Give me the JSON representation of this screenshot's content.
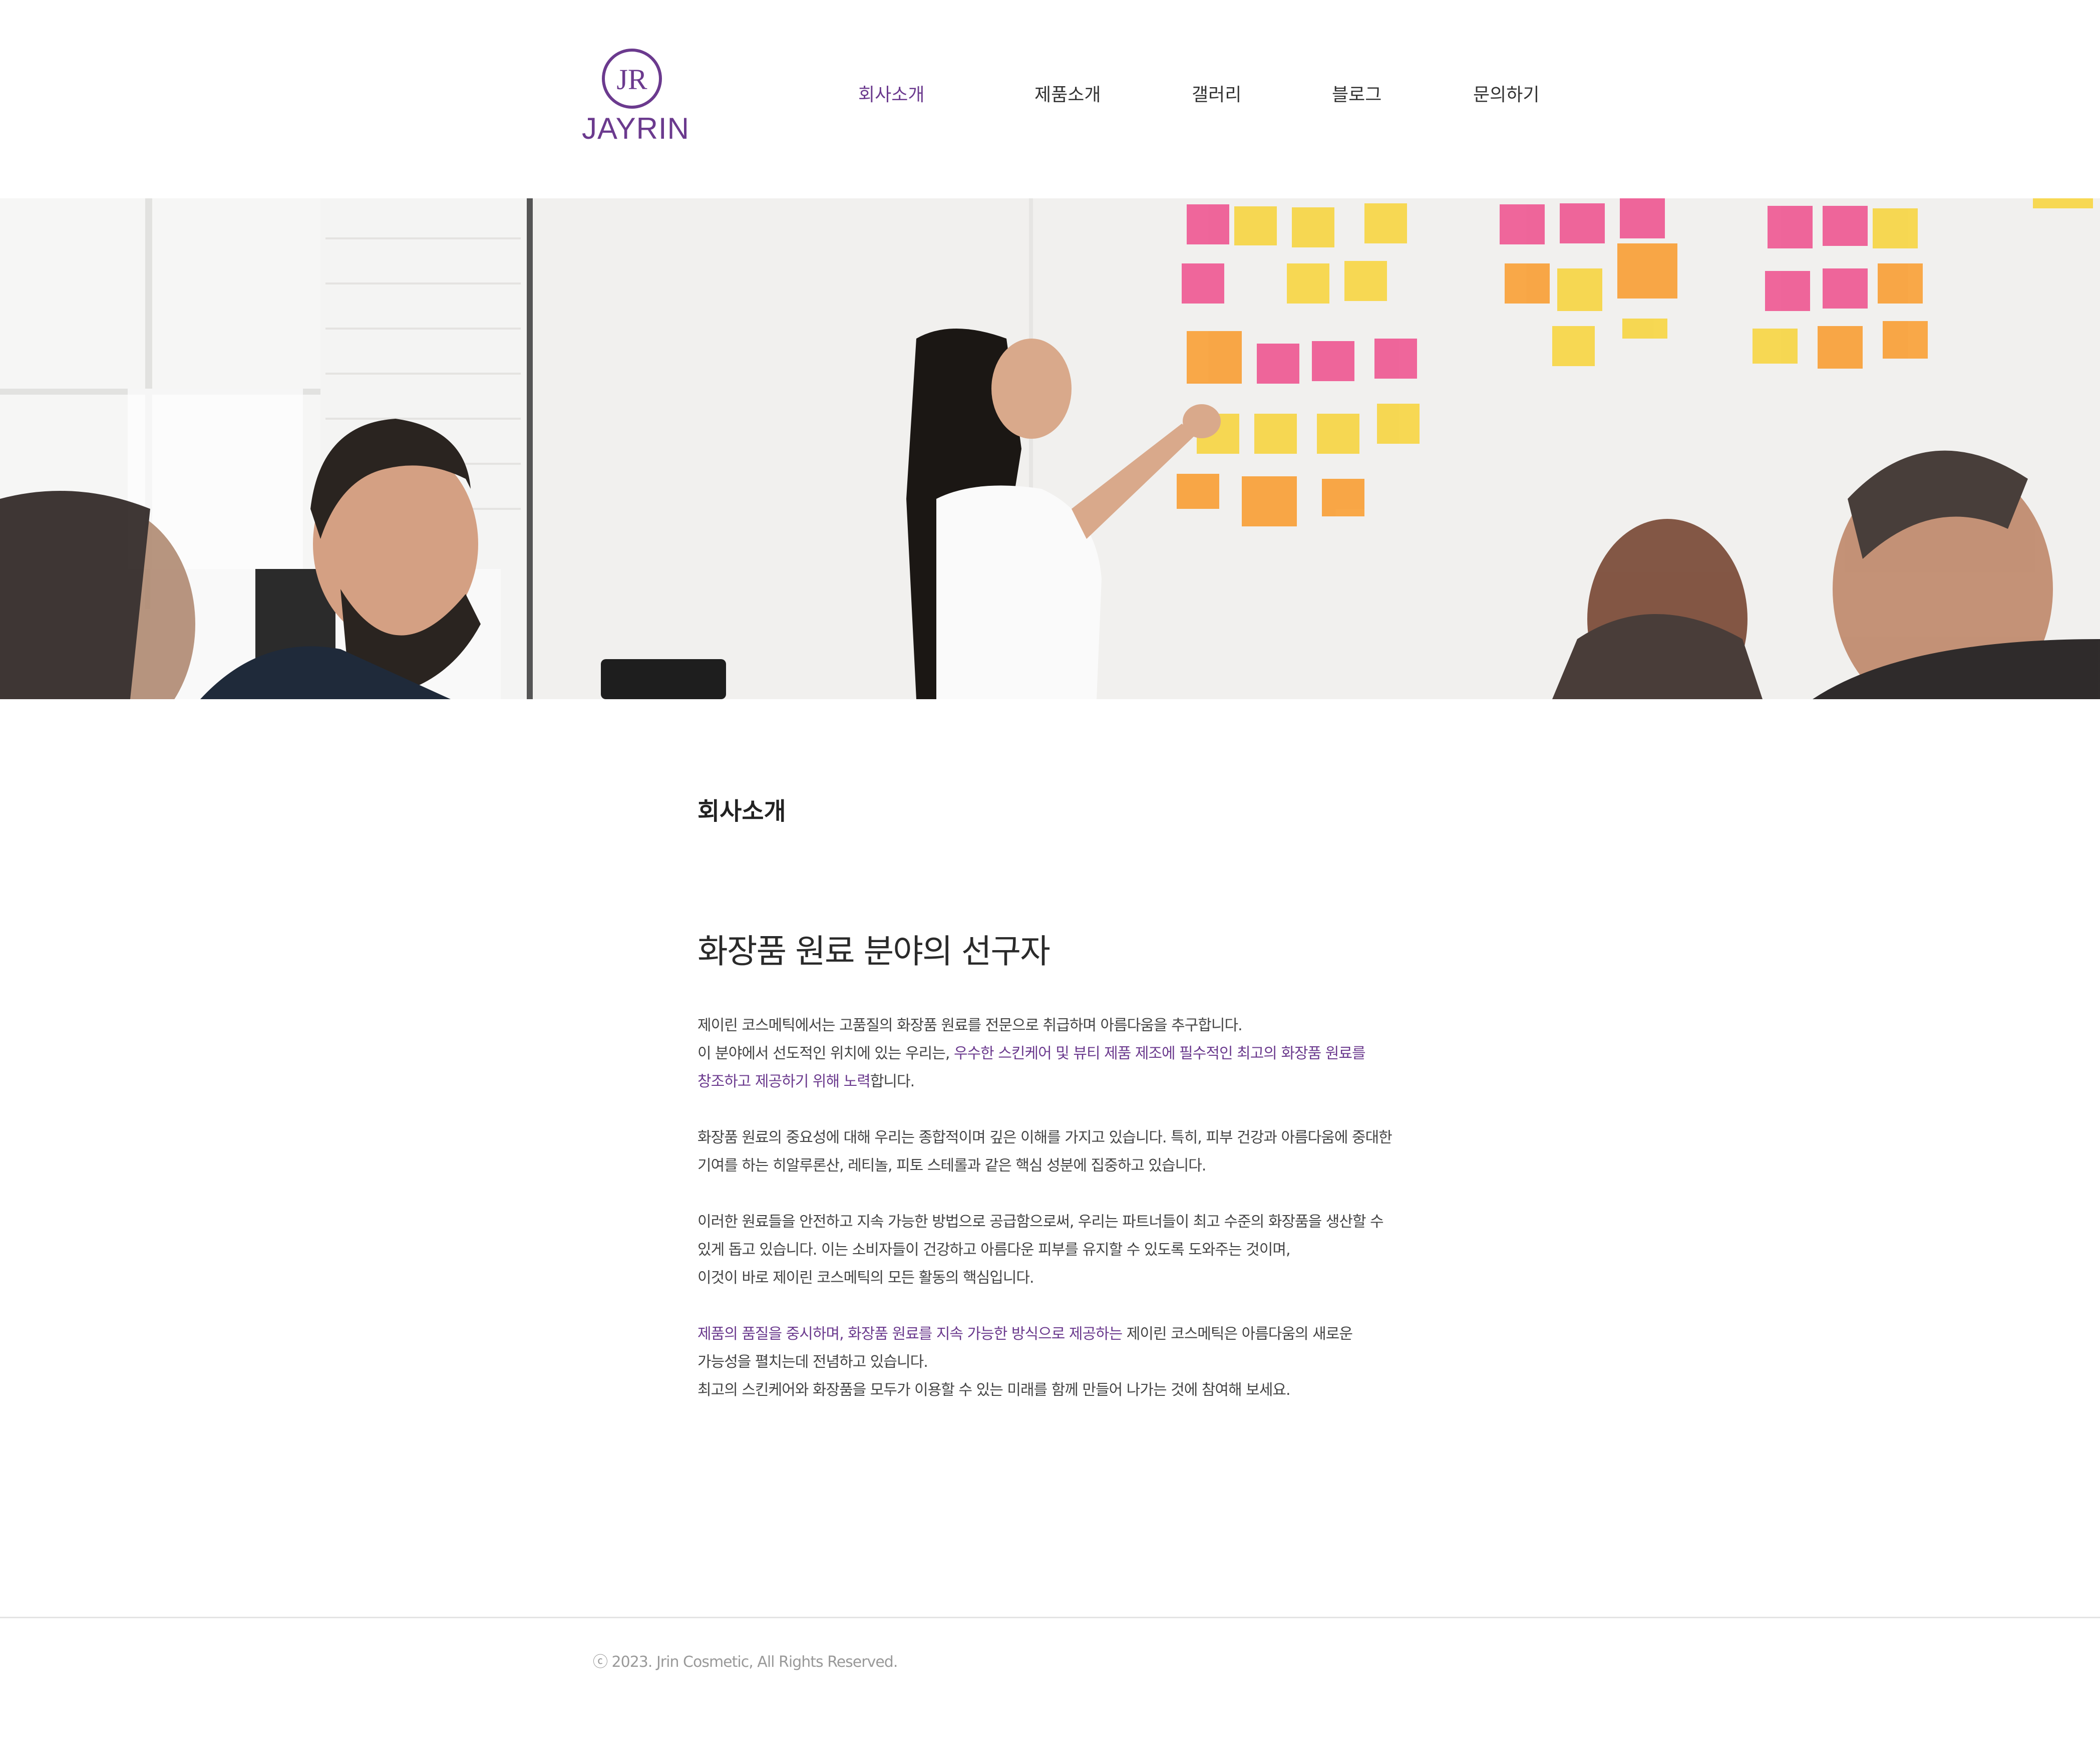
{
  "header": {
    "logo_text": "JAYRIN",
    "logo_mark": "JR",
    "nav": [
      {
        "label": "회사소개",
        "active": true
      },
      {
        "label": "제품소개",
        "active": false
      },
      {
        "label": "갤러리",
        "active": false
      },
      {
        "label": "블로그",
        "active": false
      },
      {
        "label": "문의하기",
        "active": false
      }
    ]
  },
  "hero": {
    "description_icon": "meeting-photo"
  },
  "content": {
    "section_label": "회사소개",
    "headline": "화장품 원료 분야의 선구자",
    "paragraphs": [
      {
        "lines": [
          {
            "plain_before": "제이린 코스메틱에서는 고품질의 화장품 원료를 전문으로 취급하며 아름다움을 추구합니다."
          },
          {
            "plain_before": "이 분야에서 선도적인 위치에 있는 우리는, ",
            "highlight": "우수한 스킨케어 및 뷰티 제품 제조에 필수적인 최고의 화장품 원료를"
          },
          {
            "highlight": "창조하고 제공하기 위해 노력",
            "plain_after": "합니다."
          }
        ]
      },
      {
        "lines": [
          {
            "plain_before": "화장품 원료의 중요성에 대해 우리는 종합적이며 깊은 이해를 가지고 있습니다. 특히, 피부 건강과 아름다움에 중대한"
          },
          {
            "plain_before": "기여를 하는 히알루론산, 레티놀, 피토 스테롤과 같은 핵심 성분에 집중하고 있습니다."
          }
        ]
      },
      {
        "lines": [
          {
            "plain_before": "이러한 원료들을 안전하고 지속 가능한 방법으로 공급함으로써, 우리는 파트너들이 최고 수준의 화장품을 생산할 수"
          },
          {
            "plain_before": "있게 돕고 있습니다. 이는 소비자들이 건강하고 아름다운 피부를 유지할 수 있도록 도와주는 것이며,"
          },
          {
            "plain_before": "이것이 바로 제이린 코스메틱의 모든 활동의 핵심입니다."
          }
        ]
      },
      {
        "lines": [
          {
            "highlight": "제품의 품질을 중시하며, 화장품 원료를 지속 가능한 방식으로 제공하는",
            "plain_after": " 제이린 코스메틱은 아름다움의 새로운"
          },
          {
            "plain_before": "가능성을 펼치는데 전념하고 있습니다."
          },
          {
            "plain_before": "최고의 스킨케어와 화장품을 모두가 이용할 수 있는 미래를 함께 만들어 나가는 것에 참여해 보세요."
          }
        ]
      }
    ]
  },
  "footer": {
    "copyright_symbol": "ⓒ",
    "copyright_text": " 2023. Jrin Cosmetic, All Rights Reserved."
  },
  "colors": {
    "accent": "#6b3a8e",
    "text": "#444444",
    "heading": "#2a2a2a"
  }
}
